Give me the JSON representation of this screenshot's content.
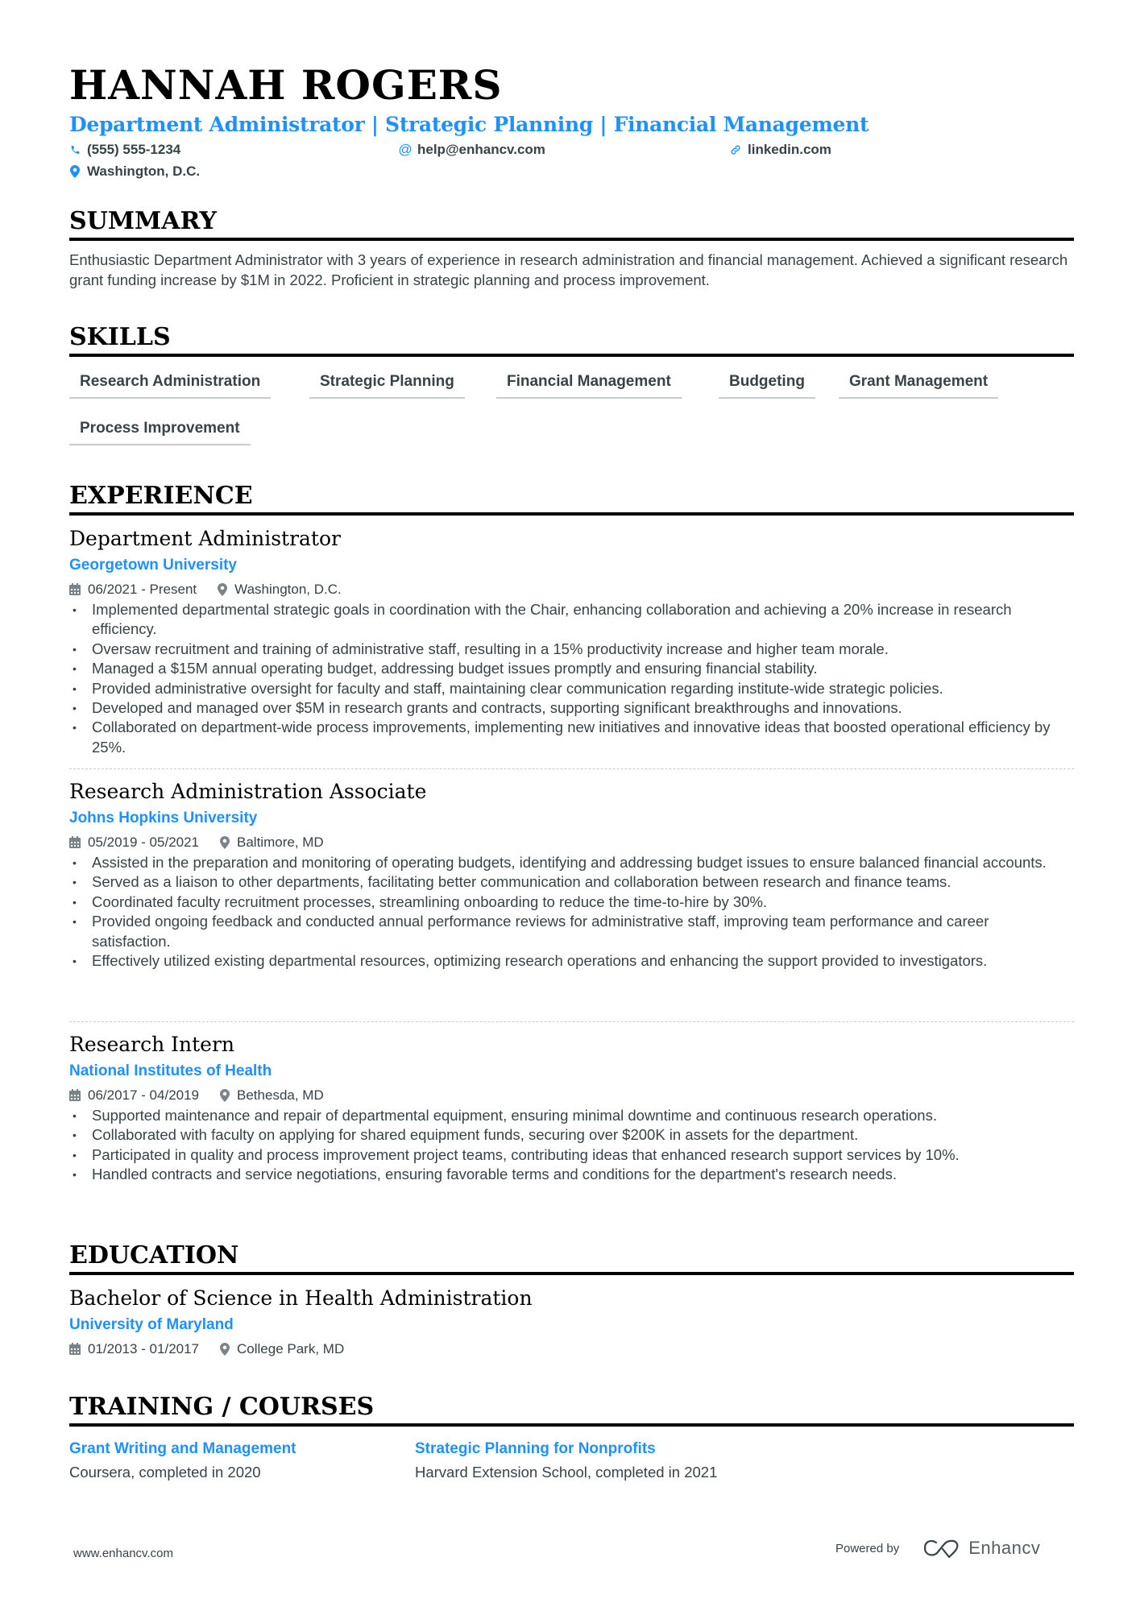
{
  "header": {
    "name": "HANNAH ROGERS",
    "title": "Department Administrator | Strategic Planning | Financial Management",
    "contacts": {
      "phone": "(555) 555-1234",
      "email": "help@enhancv.com",
      "link": "linkedin.com",
      "location": "Washington, D.C."
    },
    "icons": {
      "phone": "phone-icon",
      "email": "at-icon",
      "link": "link-icon",
      "location": "map-pin-icon"
    },
    "accent_color": "#1e90ff"
  },
  "summary": {
    "heading": "SUMMARY",
    "text": "Enthusiastic Department Administrator with 3 years of experience in research administration and financial management. Achieved a significant research grant funding increase by $1M in 2022. Proficient in strategic planning and process improvement."
  },
  "skills": {
    "heading": "SKILLS",
    "items": [
      "Research Administration",
      "Strategic Planning",
      "Financial Management",
      "Budgeting",
      "Grant Management",
      "Process Improvement"
    ]
  },
  "experience": {
    "heading": "EXPERIENCE",
    "jobs": [
      {
        "title": "Department Administrator",
        "company": "Georgetown University",
        "dates": "06/2021 - Present",
        "location": "Washington, D.C.",
        "bullets": [
          "Implemented departmental strategic goals in coordination with the Chair, enhancing collaboration and achieving a 20% increase in research efficiency.",
          "Oversaw recruitment and training of administrative staff, resulting in a 15% productivity increase and higher team morale.",
          "Managed a $15M annual operating budget, addressing budget issues promptly and ensuring financial stability.",
          "Provided administrative oversight for faculty and staff, maintaining clear communication regarding institute-wide strategic policies.",
          "Developed and managed over $5M in research grants and contracts, supporting significant breakthroughs and innovations.",
          "Collaborated on department-wide process improvements, implementing new initiatives and innovative ideas that boosted operational efficiency by 25%."
        ]
      },
      {
        "title": "Research Administration Associate",
        "company": "Johns Hopkins University",
        "dates": "05/2019 - 05/2021",
        "location": "Baltimore, MD",
        "bullets": [
          "Assisted in the preparation and monitoring of operating budgets, identifying and addressing budget issues to ensure balanced financial accounts.",
          "Served as a liaison to other departments, facilitating better communication and collaboration between research and finance teams.",
          "Coordinated faculty recruitment processes, streamlining onboarding to reduce the time-to-hire by 30%.",
          "Provided ongoing feedback and conducted annual performance reviews for administrative staff, improving team performance and career satisfaction.",
          "Effectively utilized existing departmental resources, optimizing research operations and enhancing the support provided to investigators."
        ]
      },
      {
        "title": "Research Intern",
        "company": "National Institutes of Health",
        "dates": "06/2017 - 04/2019",
        "location": "Bethesda, MD",
        "bullets": [
          "Supported maintenance and repair of departmental equipment, ensuring minimal downtime and continuous research operations.",
          "Collaborated with faculty on applying for shared equipment funds, securing over $200K in assets for the department.",
          "Participated in quality and process improvement project teams, contributing ideas that enhanced research support services by 10%.",
          "Handled contracts and service negotiations, ensuring favorable terms and conditions for the department's research needs."
        ]
      }
    ]
  },
  "education": {
    "heading": "EDUCATION",
    "degree": "Bachelor of Science in Health Administration",
    "school": "University of Maryland",
    "dates": "01/2013 - 01/2017",
    "location": "College Park, MD"
  },
  "training": {
    "heading": "TRAINING / COURSES",
    "courses": [
      {
        "title": "Grant Writing and Management",
        "description": "Coursera, completed in 2020"
      },
      {
        "title": "Strategic Planning for Nonprofits",
        "description": "Harvard Extension School, completed in 2021"
      }
    ]
  },
  "footer": {
    "website": "www.enhancv.com",
    "powered_by": "Powered by",
    "brand": "Enhancv"
  }
}
